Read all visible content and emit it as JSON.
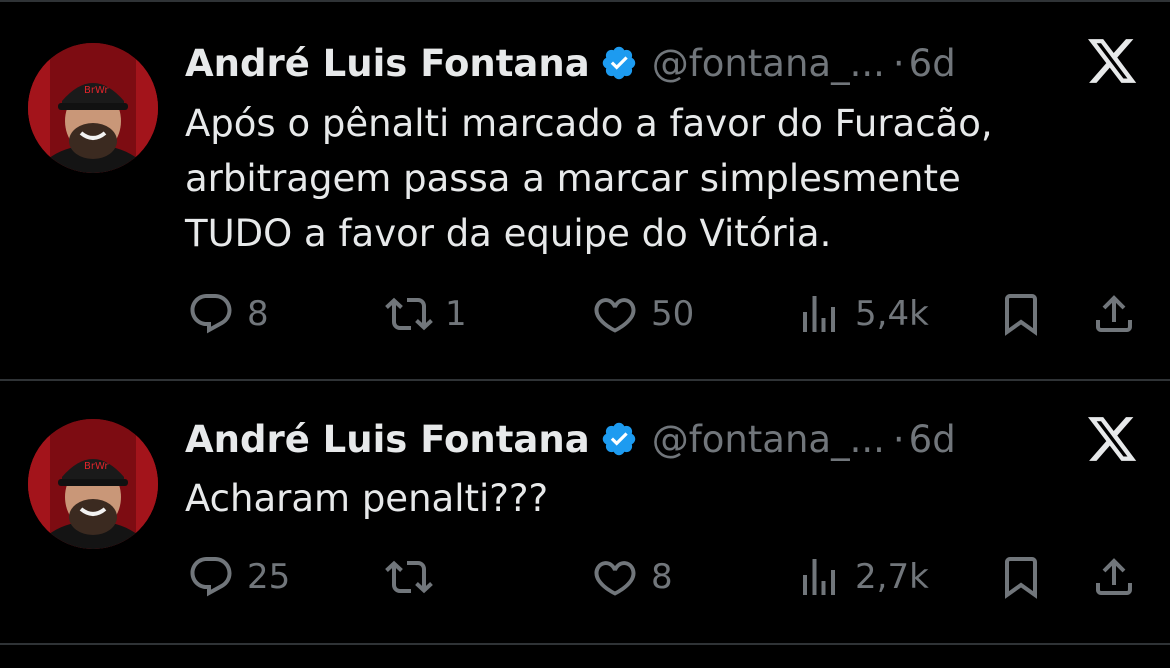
{
  "tweets": [
    {
      "author_name": "André Luis Fontana",
      "handle": "@fontana_...",
      "separator": "·",
      "time": "6d",
      "text": "Após o pênalti marcado a favor do Furacão,\narbitragem passa a marcar simplesmente\nTUDO a favor da equipe do Vitória.",
      "replies": "8",
      "retweets": "1",
      "likes": "50",
      "views": "5,4k"
    },
    {
      "author_name": "André Luis Fontana",
      "handle": "@fontana_...",
      "separator": "·",
      "time": "6d",
      "text": "Acharam penalti???",
      "replies": "25",
      "retweets": "",
      "likes": "8",
      "views": "2,7k"
    }
  ],
  "colors": {
    "background": "#000000",
    "text": "#e7e9ea",
    "muted": "#71767b",
    "verified": "#1d9bf0",
    "divider": "#2f3336"
  },
  "icons": [
    "reply-icon",
    "retweet-icon",
    "like-icon",
    "views-icon",
    "bookmark-icon",
    "share-icon",
    "x-logo-icon",
    "verified-badge-icon"
  ]
}
